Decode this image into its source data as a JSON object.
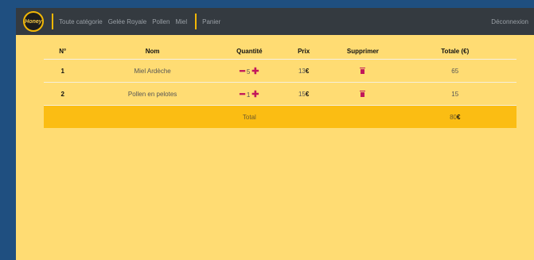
{
  "logo": {
    "text": "Honey"
  },
  "nav": {
    "links": [
      "Toute catégorie",
      "Gelée Royale",
      "Pollen",
      "Miel"
    ],
    "cart": "Panier",
    "logout": "Déconnexion"
  },
  "table": {
    "headers": [
      "N°",
      "Nom",
      "Quantité",
      "Prix",
      "Supprimer",
      "Totale (€)"
    ],
    "rows": [
      {
        "n": "1",
        "name": "Miel Ardèche",
        "qty": "5",
        "price": "13",
        "total": "65"
      },
      {
        "n": "2",
        "name": "Pollen en pelotes",
        "qty": "1",
        "price": "15",
        "total": "15"
      }
    ],
    "total_label": "Total",
    "total_value": "80",
    "currency": "€",
    "minus_glyph": "━",
    "plus_glyph": "✚"
  },
  "colors": {
    "navbar": "#343a40",
    "page": "#ffdc73",
    "accent": "#f2b705",
    "total_row": "#fbbd13",
    "control": "#c2185b"
  }
}
